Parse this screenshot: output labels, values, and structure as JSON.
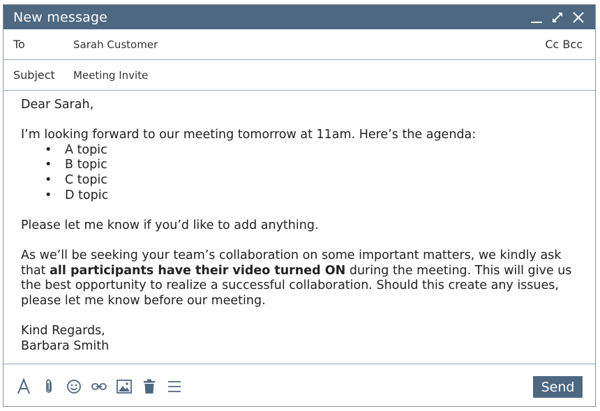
{
  "window": {
    "title": "New message"
  },
  "fields": {
    "to_label": "To",
    "to_value": "Sarah Customer",
    "cc_bcc": "Cc Bcc",
    "subject_label": "Subject",
    "subject_value": "Meeting Invite"
  },
  "message": {
    "greeting": "Dear Sarah,",
    "intro": "I’m looking forward to our meeting tomorrow at 11am. Here’s the agenda:",
    "agenda": [
      "A topic",
      "B topic",
      "C topic",
      "D topic"
    ],
    "add_request": "Please let me know if you’d like to add anything.",
    "para_before_bold": "As we’ll be seeking your team’s collaboration on some important matters, we kindly ask that ",
    "para_bold": "all participants have their video turned ON",
    "para_after_bold": " during the meeting. This will give us the best opportunity to realize a successful collaboration. Should this create any issues, please let me know before our meeting.",
    "closing": "Kind Regards,",
    "signature": "Barbara Smith"
  },
  "toolbar": {
    "icons": [
      "text-format-icon",
      "attachment-icon",
      "emoji-icon",
      "link-icon",
      "image-icon",
      "trash-icon",
      "menu-icon"
    ],
    "send_label": "Send"
  },
  "colors": {
    "titlebar": "#4e6882",
    "send_button": "#4e6882",
    "divider": "#8fa6bd"
  }
}
